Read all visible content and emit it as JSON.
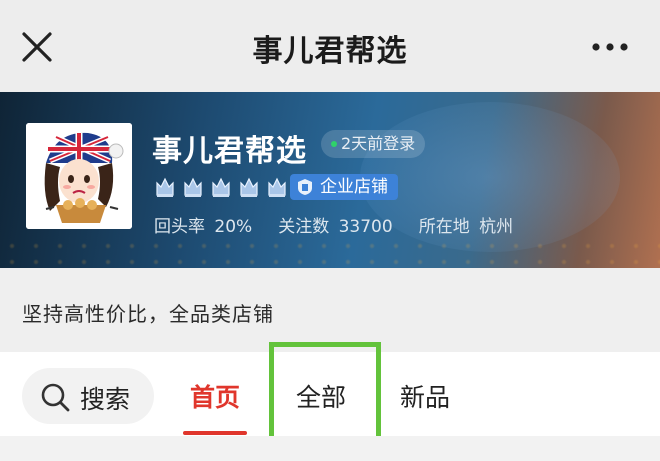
{
  "header": {
    "title": "事儿君帮选",
    "close_icon": "close-icon",
    "more_icon": "more-dots-icon"
  },
  "shop": {
    "name": "事儿君帮选",
    "online_status": "2天前登录",
    "crown_count": 5,
    "enterprise_badge": "企业店铺",
    "stats": {
      "return_rate_label": "回头率",
      "return_rate_value": "20%",
      "followers_label": "关注数",
      "followers_value": "33700",
      "location_label": "所在地",
      "location_value": "杭州"
    },
    "description": "坚持高性价比，全品类店铺"
  },
  "tabs": {
    "search_label": "搜索",
    "home": "首页",
    "all": "全部",
    "new": "新品",
    "active": "首页"
  },
  "colors": {
    "accent_red": "#e0362c",
    "highlight_green": "#63c33b",
    "enterprise_blue": "#3d82d8"
  }
}
